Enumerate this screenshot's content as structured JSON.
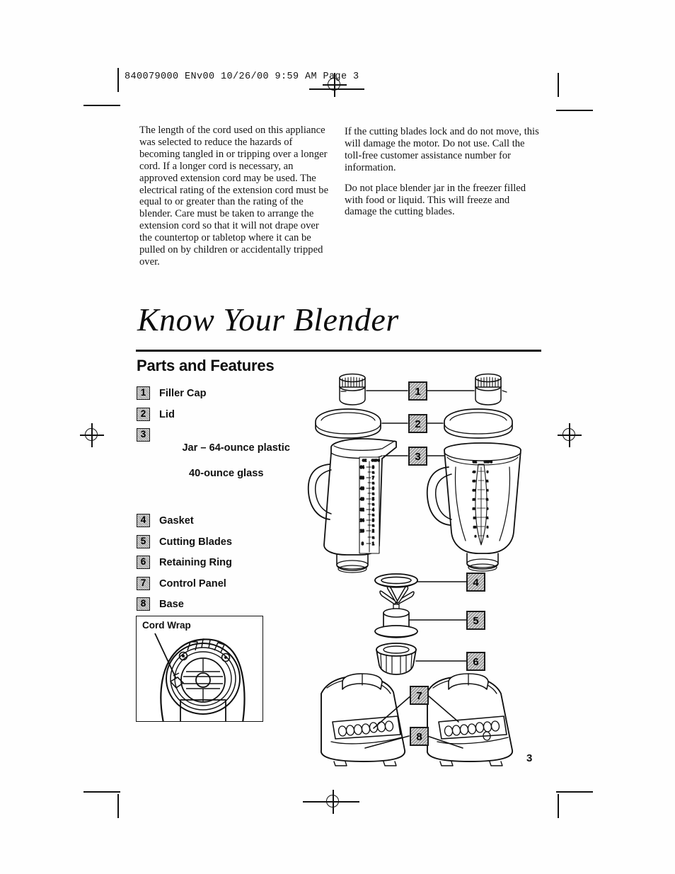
{
  "document": {
    "slug_line": "840079000  ENv00  10/26/00  9:59 AM   Page 3",
    "page_number": "3",
    "section_title": "Know Your Blender",
    "subsection_title": "Parts and Features"
  },
  "body": {
    "left_column": [
      "The length of the cord used on this appliance was selected to reduce the hazards of becoming tangled in or tripping over a longer cord. If a longer cord is necessary, an approved extension cord may be used. The electrical rating of the extension cord must be equal to or greater than the rating of the blender. Care must be taken to arrange the extension cord so that it will not drape over the countertop or tabletop where it can be pulled on by children or accidentally tripped over."
    ],
    "right_column": [
      "If the cutting blades lock and do not move, this will damage the motor. Do not use. Call the toll-free customer assistance number for information.",
      "Do not place blender jar in the freezer filled with food or liquid. This will freeze and damage the cutting blades."
    ]
  },
  "parts": [
    {
      "number": "1",
      "label": "Filler Cap",
      "sub": ""
    },
    {
      "number": "2",
      "label": "Lid",
      "sub": ""
    },
    {
      "number": "3",
      "label": "Jar – 64-ounce plastic",
      "sub": "40-ounce glass"
    },
    {
      "number": "4",
      "label": "Gasket",
      "sub": ""
    },
    {
      "number": "5",
      "label": "Cutting Blades",
      "sub": ""
    },
    {
      "number": "6",
      "label": "Retaining Ring",
      "sub": ""
    },
    {
      "number": "7",
      "label": "Control Panel",
      "sub": ""
    },
    {
      "number": "8",
      "label": "Base",
      "sub": ""
    }
  ],
  "inset": {
    "cord_wrap_label": "Cord Wrap"
  },
  "diagram": {
    "callouts": [
      "1",
      "2",
      "3",
      "4",
      "5",
      "6",
      "7",
      "8"
    ],
    "jar_scale": {
      "header_left": "OZ",
      "header_right": "CUPS",
      "ounces": [
        "64",
        "56",
        "48",
        "40",
        "32",
        "24",
        "16",
        "8"
      ],
      "cups": [
        "8",
        "7",
        "6",
        "5",
        "4",
        "3",
        "2",
        "1"
      ],
      "cups_half": [
        "½",
        "½",
        "½",
        "½",
        "½",
        "½",
        "½"
      ]
    }
  },
  "colors": {
    "ink": "#111111",
    "callout_fill": "#c9c9c9",
    "paper": "#ffffff"
  }
}
